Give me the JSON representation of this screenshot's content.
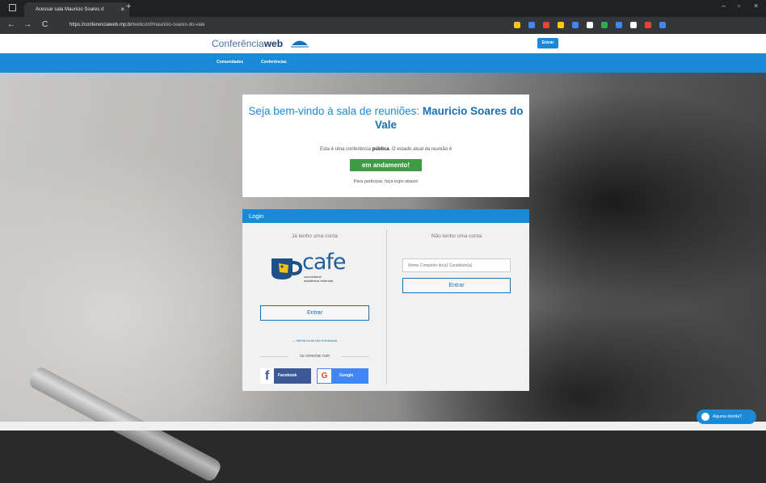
{
  "browser": {
    "tab_title": "Acessar sala Mauricio Soares d",
    "tab_close": "×",
    "new_tab": "+",
    "url_host": "https://conferenciaweb.rnp.br",
    "url_path": "/webconf/mauricio-soares-do-vale",
    "back": "←",
    "forward": "→",
    "reload": "C",
    "minimize": "–",
    "maximize": "▫",
    "close": "×",
    "extension_colors": [
      "#f0c419",
      "#4285f4",
      "#ea4335",
      "#ffcc00",
      "#4285f4",
      "#ffffff",
      "#34a853",
      "#4285f4",
      "#ffffff",
      "#ea4335",
      "#4285f4"
    ]
  },
  "site": {
    "logo_prefix": "Conferência",
    "logo_bold": "web",
    "header_login": "Entrar",
    "menu": [
      "Comunidades",
      "Conferências"
    ]
  },
  "welcome": {
    "title_prefix": "Seja bem-vindo à sala de reuniões: ",
    "title_name": "Mauricio Soares do Vale",
    "status_prefix": "Esta é uma conferência ",
    "status_public": "pública",
    "status_suffix": ". O estado atual da reunião é",
    "status_badge": "em andamento!",
    "participate_text": "Para participar, faça login abaixo"
  },
  "login": {
    "header": "Login",
    "left_title": "Já tenho uma conta",
    "cafe_word": "cafe",
    "cafe_sub_1": "comunidade",
    "cafe_sub_2": "acadêmica federada",
    "cafe_enter": "Entrar",
    "not_federated": "— Minha conta não é federada",
    "or_connect": "ou conectar com",
    "facebook_icon": "f",
    "facebook": "Facebook",
    "google_icon": "G",
    "google": "Google",
    "right_title": "Não tenho uma conta",
    "name_placeholder": "Nome Completo do(a) Candidato(a)",
    "guest_enter": "Entrar"
  },
  "help": {
    "label": "Alguma dúvida?"
  }
}
